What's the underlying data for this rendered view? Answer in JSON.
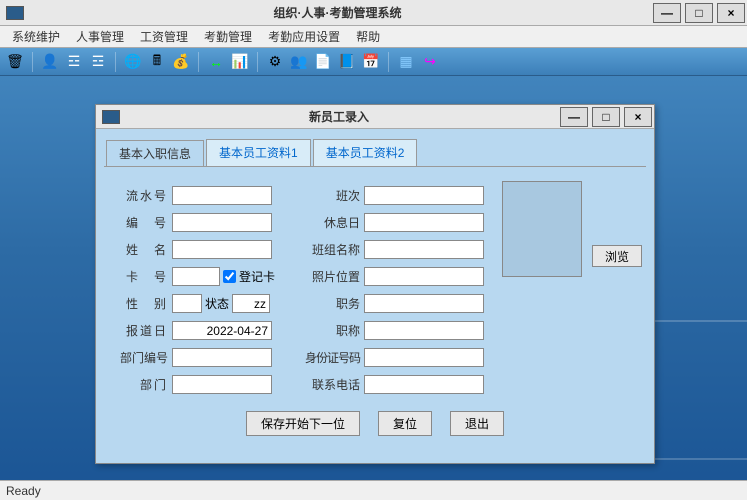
{
  "mainWindow": {
    "title": "组织·人事·考勤管理系统",
    "menus": [
      "系统维护",
      "人事管理",
      "工资管理",
      "考勤管理",
      "考勤应用设置",
      "帮助"
    ],
    "status": "Ready"
  },
  "childWindow": {
    "title": "新员工录入",
    "tabs": [
      "基本入职信息",
      "基本员工资料1",
      "基本员工资料2"
    ],
    "browse": "浏览",
    "buttons": {
      "save": "保存开始下一位",
      "reset": "复位",
      "exit": "退出"
    }
  },
  "left": {
    "serial": {
      "label": "流水号",
      "value": ""
    },
    "empno": {
      "label": "编　号",
      "value": ""
    },
    "name": {
      "label": "姓　名",
      "value": ""
    },
    "card": {
      "label": "卡　号",
      "value": "",
      "chk": "登记卡"
    },
    "gender": {
      "label": "性　别",
      "value": "",
      "statusLbl": "状态",
      "statusVal": "zz"
    },
    "report": {
      "label": "报道日",
      "value": "2022-04-27"
    },
    "deptno": {
      "label": "部门编号",
      "value": ""
    },
    "dept": {
      "label": "部门",
      "value": ""
    }
  },
  "right": {
    "shift": {
      "label": "班次",
      "value": ""
    },
    "rest": {
      "label": "休息日",
      "value": ""
    },
    "team": {
      "label": "班组名称",
      "value": ""
    },
    "photo": {
      "label": "照片位置",
      "value": ""
    },
    "duty": {
      "label": "职务",
      "value": ""
    },
    "title": {
      "label": "职称",
      "value": ""
    },
    "idno": {
      "label": "身份证号码",
      "value": ""
    },
    "phone": {
      "label": "联系电话",
      "value": ""
    }
  }
}
